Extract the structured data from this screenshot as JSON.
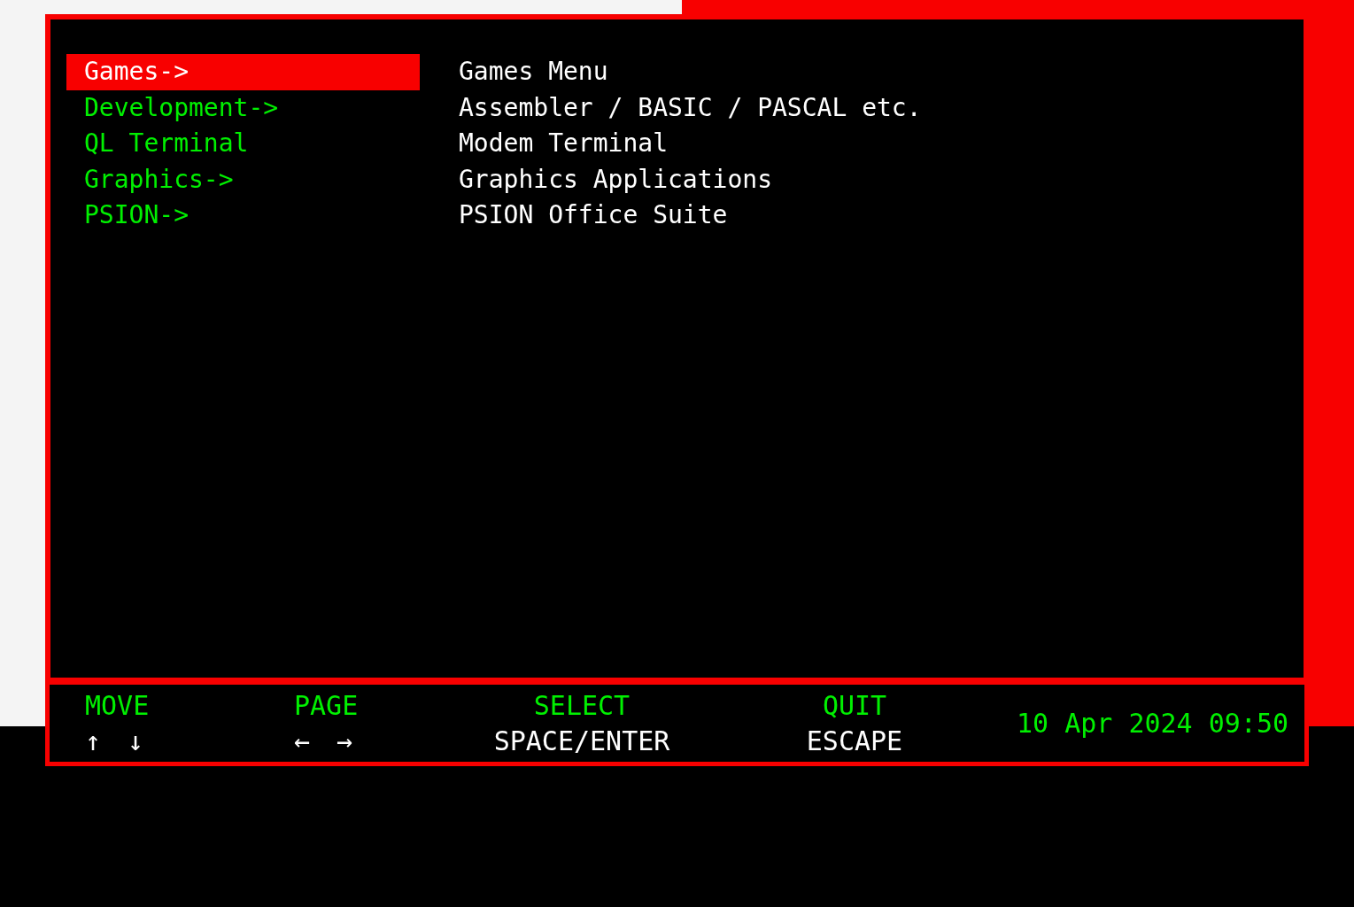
{
  "menu": {
    "items": [
      {
        "label": "Games->",
        "description": "Games Menu",
        "selected": true
      },
      {
        "label": "Development->",
        "description": "Assembler / BASIC / PASCAL etc.",
        "selected": false
      },
      {
        "label": "QL Terminal",
        "description": "Modem Terminal",
        "selected": false
      },
      {
        "label": "Graphics->",
        "description": "Graphics Applications",
        "selected": false
      },
      {
        "label": "PSION->",
        "description": "PSION Office Suite",
        "selected": false
      }
    ]
  },
  "footer": {
    "keys": [
      {
        "action": "MOVE",
        "keys": "↑ ↓"
      },
      {
        "action": "PAGE",
        "keys": "← →"
      },
      {
        "action": "SELECT",
        "keys": "SPACE/ENTER"
      },
      {
        "action": "QUIT",
        "keys": "ESCAPE"
      }
    ],
    "datetime": "10 Apr 2024 09:50"
  }
}
